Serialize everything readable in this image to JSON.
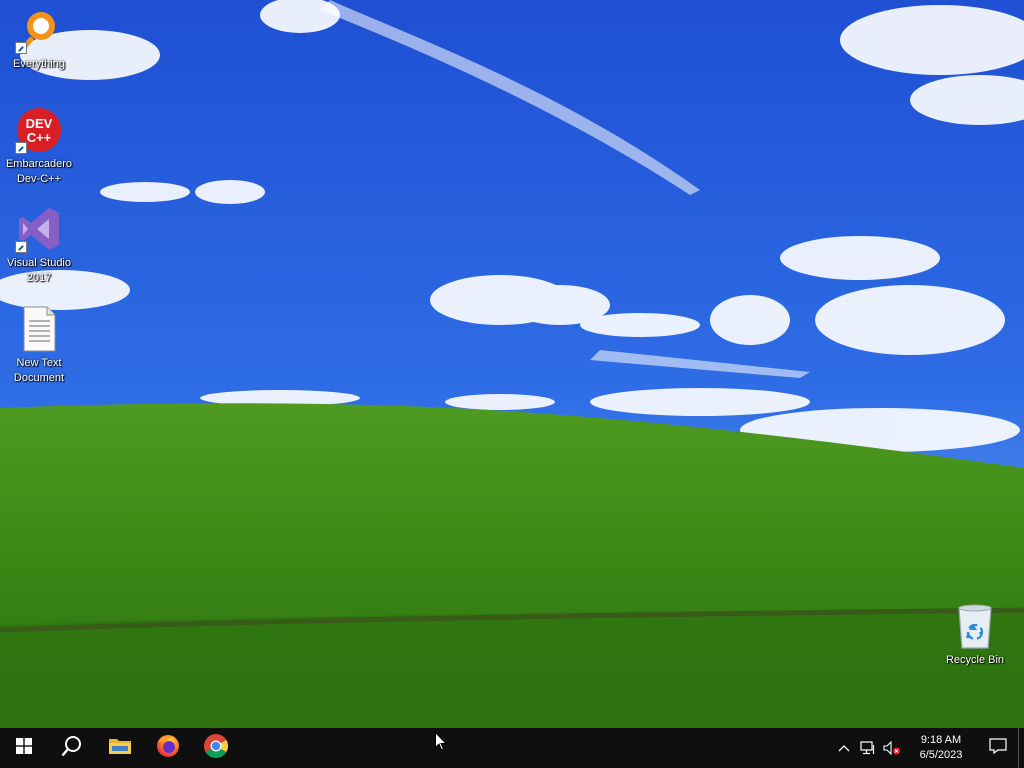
{
  "desktop": {
    "icons": [
      {
        "label": "Everything",
        "icon": "everything-icon"
      },
      {
        "label": "Embarcadero Dev-C++",
        "icon": "devcpp-icon",
        "glyph_text": "DEV C++"
      },
      {
        "label": "Visual Studio 2017",
        "icon": "visual-studio-icon"
      },
      {
        "label": "New Text Document",
        "icon": "text-document-icon"
      },
      {
        "label": "Recycle Bin",
        "icon": "recycle-bin-icon"
      }
    ]
  },
  "taskbar": {
    "buttons": [
      {
        "name": "start",
        "icon": "windows-logo-icon"
      },
      {
        "name": "search",
        "icon": "search-icon"
      },
      {
        "name": "file-explorer",
        "icon": "folder-icon"
      },
      {
        "name": "firefox",
        "icon": "firefox-icon"
      },
      {
        "name": "chrome",
        "icon": "chrome-icon"
      }
    ],
    "tray": {
      "time": "9:18 AM",
      "date": "6/5/2023",
      "icons": [
        "chevron-up-icon",
        "network-icon",
        "volume-muted-icon",
        "notification-icon"
      ]
    }
  },
  "colors": {
    "taskbar": "#0f0f10",
    "sky": "#2a62e0",
    "grass": "#3f8a1c"
  }
}
